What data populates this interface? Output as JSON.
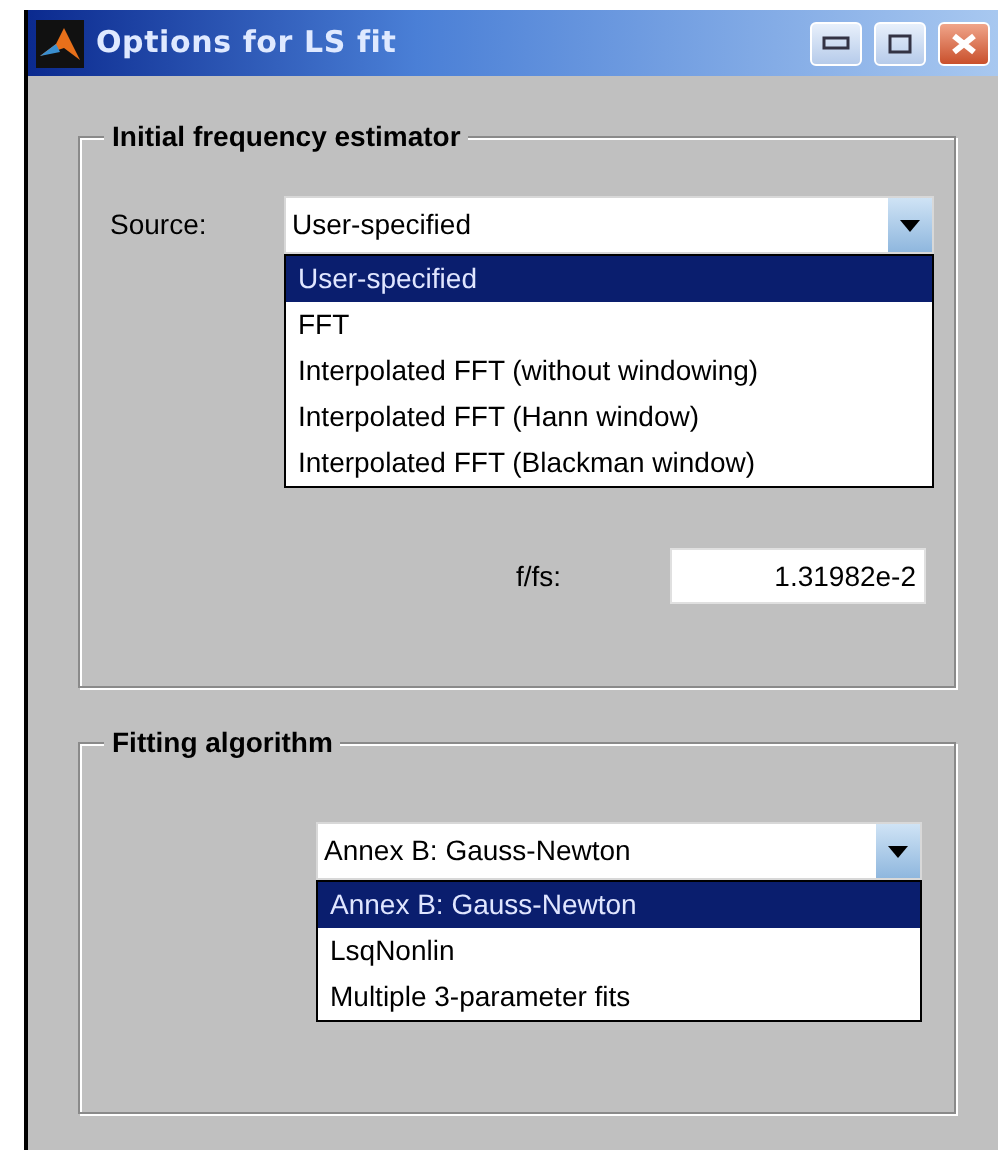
{
  "window": {
    "title": "Options for LS fit"
  },
  "initial_frequency_estimator": {
    "title": "Initial frequency estimator",
    "source": {
      "label": "Source:",
      "value": "User-specified",
      "options": [
        {
          "label": "User-specified",
          "selected": true
        },
        {
          "label": "FFT",
          "selected": false
        },
        {
          "label": "Interpolated FFT (without windowing)",
          "selected": false
        },
        {
          "label": "Interpolated FFT (Hann window)",
          "selected": false
        },
        {
          "label": "Interpolated FFT (Blackman window)",
          "selected": false
        }
      ]
    },
    "ratio": {
      "label": "f/fs:",
      "value": "1.31982e-2"
    }
  },
  "fitting_algorithm": {
    "title": "Fitting algorithm",
    "method": {
      "value": "Annex B: Gauss-Newton",
      "options": [
        {
          "label": "Annex B: Gauss-Newton",
          "selected": true
        },
        {
          "label": "LsqNonlin",
          "selected": false
        },
        {
          "label": "Multiple 3-parameter fits",
          "selected": false
        }
      ]
    }
  }
}
